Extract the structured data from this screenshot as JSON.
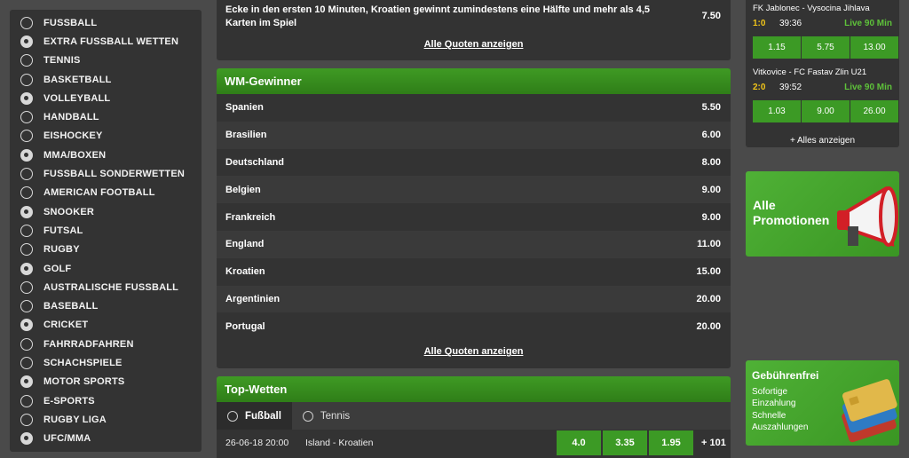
{
  "sidebar": {
    "items": [
      {
        "label": "FUSSBALL",
        "icon": "soccer-ball-icon"
      },
      {
        "label": "EXTRA FUSSBALL WETTEN",
        "icon": "soccer-ball-icon"
      },
      {
        "label": "TENNIS",
        "icon": "tennis-ball-icon"
      },
      {
        "label": "BASKETBALL",
        "icon": "basketball-icon"
      },
      {
        "label": "VOLLEYBALL",
        "icon": "volleyball-icon"
      },
      {
        "label": "HANDBALL",
        "icon": "handball-icon"
      },
      {
        "label": "EISHOCKEY",
        "icon": "hockey-stick-icon"
      },
      {
        "label": "MMA/BOXEN",
        "icon": "boxing-glove-icon"
      },
      {
        "label": "FUSSBALL SONDERWETTEN",
        "icon": "soccer-ball-icon"
      },
      {
        "label": "AMERICAN FOOTBALL",
        "icon": "american-football-icon"
      },
      {
        "label": "SNOOKER",
        "icon": "snooker-ball-icon"
      },
      {
        "label": "FUTSAL",
        "icon": "futsal-ball-icon"
      },
      {
        "label": "RUGBY",
        "icon": "rugby-ball-icon"
      },
      {
        "label": "GOLF",
        "icon": "golf-ball-icon"
      },
      {
        "label": "AUSTRALISCHE FUSSBALL",
        "icon": "aussie-rules-ball-icon"
      },
      {
        "label": "BASEBALL",
        "icon": "baseball-icon"
      },
      {
        "label": "CRICKET",
        "icon": "cricket-ball-icon"
      },
      {
        "label": "FAHRRADFAHREN",
        "icon": "cyclist-icon"
      },
      {
        "label": "SCHACHSPIELE",
        "icon": "chess-piece-icon"
      },
      {
        "label": "MOTOR SPORTS",
        "icon": "checkered-flag-icon"
      },
      {
        "label": "E-SPORTS",
        "icon": "gamepad-icon"
      },
      {
        "label": "RUGBY LIGA",
        "icon": "rugby-ball-icon"
      },
      {
        "label": "UFC/MMA",
        "icon": "fist-icon"
      }
    ]
  },
  "special": {
    "text": "Ecke in den ersten 10 Minuten, Kroatien gewinnt zumindestens eine Hälfte und mehr als 4,5 Karten im Spiel",
    "odd": "7.50",
    "show_all": "Alle Quoten anzeigen"
  },
  "wm": {
    "title": "WM-Gewinner",
    "rows": [
      {
        "team": "Spanien",
        "odd": "5.50"
      },
      {
        "team": "Brasilien",
        "odd": "6.00"
      },
      {
        "team": "Deutschland",
        "odd": "8.00"
      },
      {
        "team": "Belgien",
        "odd": "9.00"
      },
      {
        "team": "Frankreich",
        "odd": "9.00"
      },
      {
        "team": "England",
        "odd": "11.00"
      },
      {
        "team": "Kroatien",
        "odd": "15.00"
      },
      {
        "team": "Argentinien",
        "odd": "20.00"
      },
      {
        "team": "Portugal",
        "odd": "20.00"
      }
    ],
    "show_all": "Alle Quoten anzeigen"
  },
  "top": {
    "title": "Top-Wetten",
    "tabs": [
      {
        "label": "Fußball",
        "icon": "soccer-ball-icon"
      },
      {
        "label": "Tennis",
        "icon": "tennis-ball-icon"
      }
    ],
    "match": {
      "date": "26-06-18 20:00",
      "name": "Island - Kroatien",
      "odds": [
        "4.0",
        "3.35",
        "1.95"
      ],
      "more": "+ 101"
    }
  },
  "live": {
    "matches": [
      {
        "title": "FK Jablonec - Vysocina Jihlava",
        "score": "1:0",
        "time": "39:36",
        "status": "Live 90 Min",
        "odds": [
          "1.15",
          "5.75",
          "13.00"
        ]
      },
      {
        "title": "Vitkovice - FC Fastav Zlin U21",
        "score": "2:0",
        "time": "39:52",
        "status": "Live 90 Min",
        "odds": [
          "1.03",
          "9.00",
          "26.00"
        ]
      }
    ],
    "show_all": "+ Alles anzeigen"
  },
  "promo1": {
    "line1": "Alle",
    "line2": "Promotionen"
  },
  "promo2": {
    "head": "Gebührenfrei",
    "lines": [
      "Sofortige",
      "Einzahlung",
      "Schnelle",
      "Auszahlungen"
    ]
  },
  "colors": {
    "accent": "#3c9a25",
    "score": "#f0c419",
    "live": "#5ec23a",
    "panel": "#333333",
    "background": "#4a4a4a"
  }
}
